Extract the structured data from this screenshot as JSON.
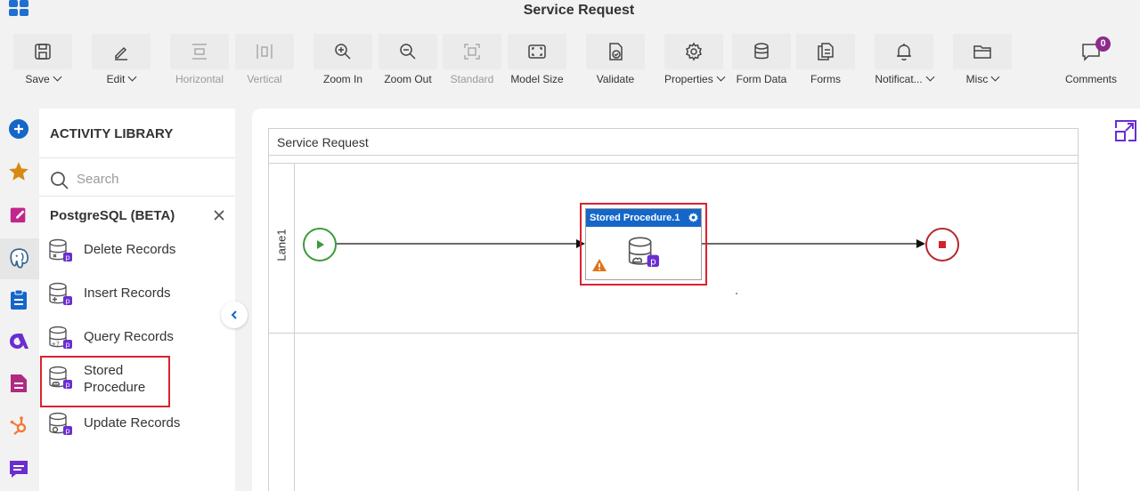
{
  "window": {
    "title": "Service Request"
  },
  "toolbar": {
    "save": "Save",
    "edit": "Edit",
    "horizontal": "Horizontal",
    "vertical": "Vertical",
    "zoom_in": "Zoom In",
    "zoom_out": "Zoom Out",
    "standard": "Standard",
    "model_size": "Model Size",
    "validate": "Validate",
    "properties": "Properties",
    "form_data": "Form Data",
    "forms": "Forms",
    "notifications": "Notificat...",
    "misc": "Misc",
    "comments": "Comments",
    "comments_count": "0"
  },
  "library": {
    "title": "ACTIVITY LIBRARY",
    "search_placeholder": "Search",
    "category": "PostgreSQL (BETA)",
    "items": [
      {
        "label": "Delete Records"
      },
      {
        "label": "Insert Records"
      },
      {
        "label": "Query Records"
      },
      {
        "label": "Stored Procedure"
      },
      {
        "label": "Update Records"
      }
    ]
  },
  "canvas": {
    "pool_title": "Service Request",
    "lane_label": "Lane1",
    "task_title": "Stored Procedure.1"
  },
  "colors": {
    "accent_blue": "#1466c8",
    "highlight_red": "#d9232e",
    "start_green": "#3c9a3c",
    "end_red": "#b4282e",
    "badge_purple": "#8e2a8c"
  }
}
